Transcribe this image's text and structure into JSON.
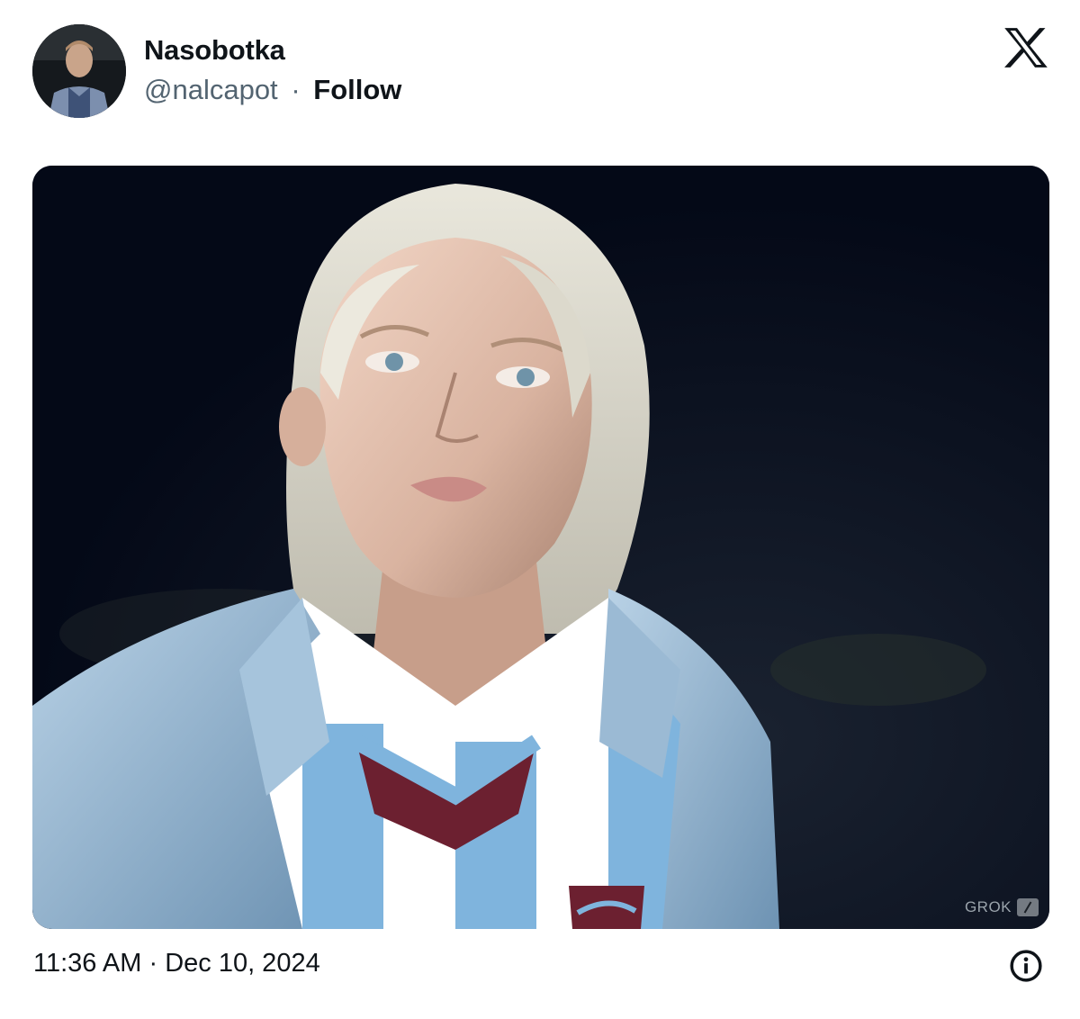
{
  "author": {
    "name": "Nasobotka",
    "handle": "@nalcapot",
    "separator": "·",
    "follow_label": "Follow"
  },
  "icons": {
    "logo": "x-logo-icon",
    "info": "info-icon"
  },
  "media": {
    "watermark": "GROK"
  },
  "footer": {
    "time": "11:36 AM",
    "separator": "·",
    "date": "Dec 10, 2024"
  },
  "colors": {
    "text": "#0f1419",
    "secondary": "#536471",
    "media_background": "#050a1a"
  }
}
